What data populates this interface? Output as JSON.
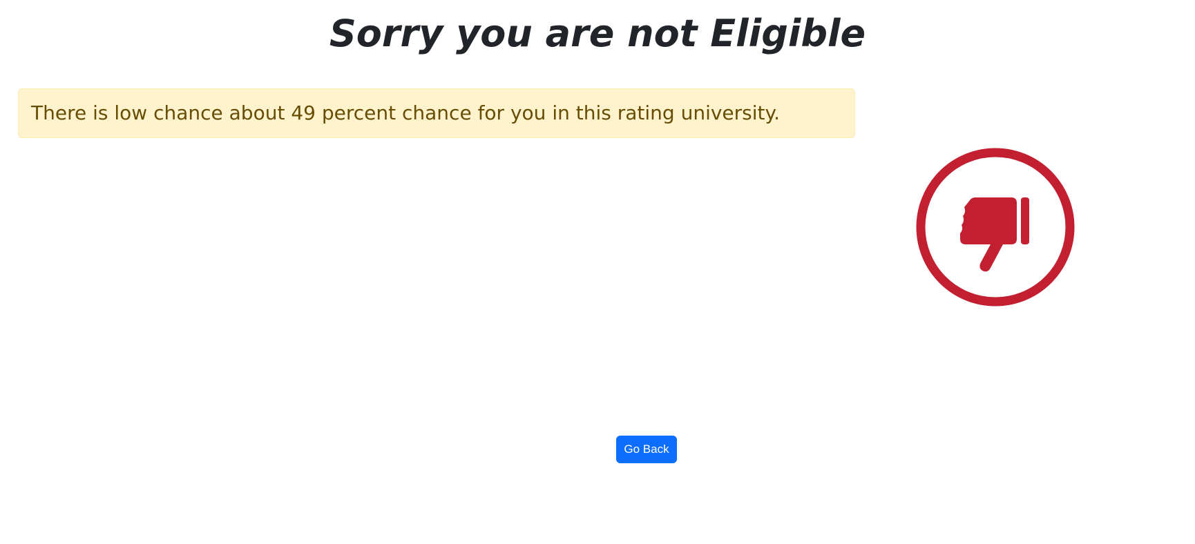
{
  "header": {
    "title": "Sorry you are not Eligible"
  },
  "result": {
    "message": "There is low chance about 49 percent chance for you in this rating university.",
    "verdict_icon": "thumbs-down-circle-icon",
    "icon_color": "#c21f30",
    "alert_background": "#fff3cd",
    "alert_text_color": "#664d03"
  },
  "actions": {
    "go_back_label": "Go Back",
    "button_color": "#0d6efd"
  }
}
